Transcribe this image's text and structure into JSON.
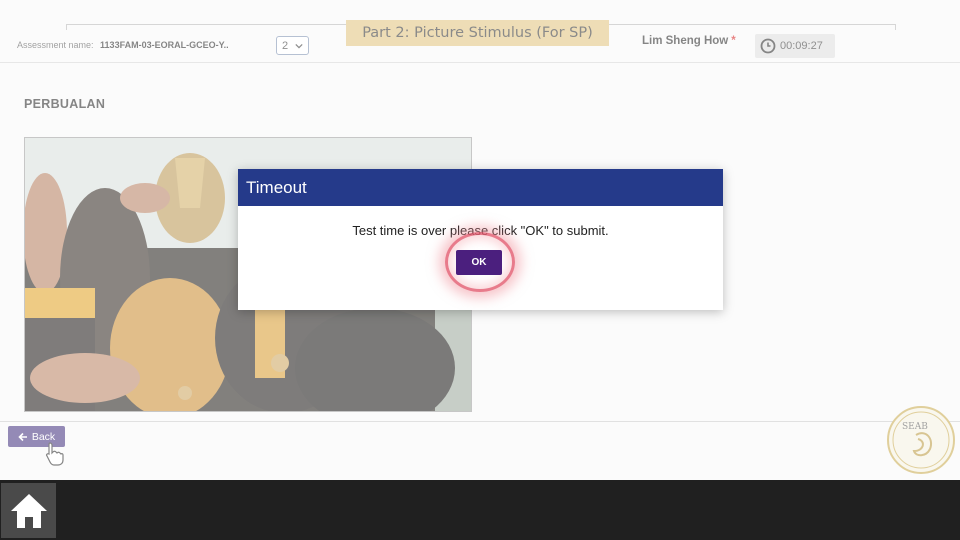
{
  "header": {
    "section_banner": "Part 2: Picture Stimulus (For SP)",
    "assessment_label": "Assessment name:",
    "assessment_name": "1133FAM-03-EORAL-GCEO-Y..",
    "part_select_value": "2",
    "user_name": "Lim Sheng How",
    "required_mark": "*",
    "timer": "00:09:27"
  },
  "main": {
    "section_title": "PERBUALAN",
    "stimulus_image": "team-celebrating-with-trophy-photo"
  },
  "footer": {
    "back_label": "Back",
    "logo_text": "SEAB"
  },
  "dialog": {
    "title": "Timeout",
    "message": "Test time is over please click \"OK\" to submit.",
    "ok_label": "OK"
  },
  "colors": {
    "banner": "#e0c27a",
    "dialog_header": "#253a8a",
    "ok_button": "#4b1f7e",
    "back_button": "#3d2a7a",
    "taskbar": "#202020"
  }
}
